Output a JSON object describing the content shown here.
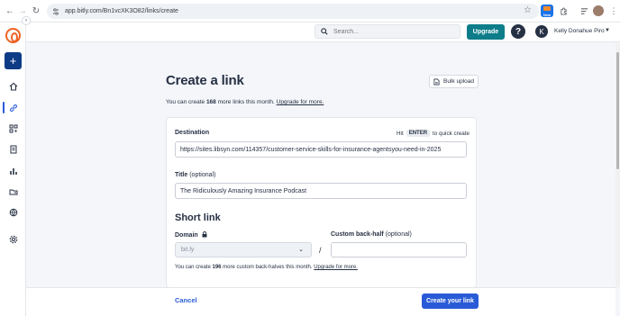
{
  "browser": {
    "url": "app.bitly.com/Bn1vcXK3O82/links/create",
    "ext_badge": "New"
  },
  "topbar": {
    "search_placeholder": "Search...",
    "upgrade_label": "Upgrade",
    "help_label": "?",
    "avatar_initial": "K",
    "account_name": "Kelly Donahue Piro"
  },
  "sidebar": {
    "create_label": "+",
    "active_item": "links"
  },
  "page": {
    "title": "Create a link",
    "bulk_upload_label": "Bulk upload",
    "quota_prefix": "You can create ",
    "quota_count": "168",
    "quota_suffix": " more links this month. ",
    "quota_link": "Upgrade for more."
  },
  "form": {
    "destination_label": "Destination",
    "hint_prefix": "Hit",
    "hint_key": "ENTER",
    "hint_suffix": "to quick create",
    "destination_value": "https://sites.libsyn.com/114357/customer-service-skills-for-insurance-agentsyou-need-in-2025",
    "title_label": "Title",
    "title_optional": "(optional)",
    "title_value": "The Ridiculously Amazing Insurance Podcast",
    "short_link_heading": "Short link",
    "domain_label": "Domain",
    "domain_value": "bit.ly",
    "slash": "/",
    "backhalf_label": "Custom back-half",
    "backhalf_optional": "(optional)",
    "backhalf_value": "",
    "backhalf_note_prefix": "You can create ",
    "backhalf_note_count": "196",
    "backhalf_note_suffix": " more custom back-halves this month. ",
    "backhalf_note_link": "Upgrade for more."
  },
  "footer": {
    "cancel_label": "Cancel",
    "create_label": "Create your link"
  },
  "colors": {
    "brand_orange": "#ee6123",
    "nav_navy": "#0d3b86",
    "upgrade_teal": "#0d7d8a",
    "primary_blue": "#2a5bd7"
  }
}
